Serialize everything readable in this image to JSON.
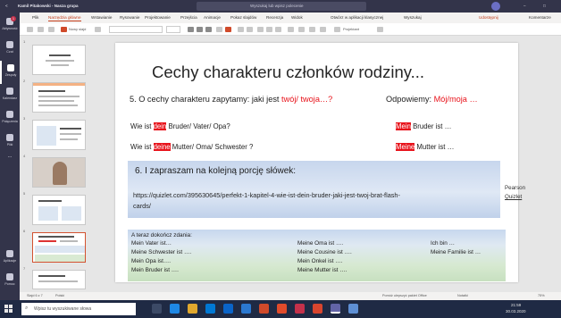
{
  "teams": {
    "back": "<",
    "title": "Kamil Pitakowski - Nasza grupa",
    "search_placeholder": "Wyszukaj lub wpisz polecenie",
    "minimize": "–",
    "maximize": "□",
    "rail": [
      {
        "label": "Aktywność",
        "badge": "1"
      },
      {
        "label": "Czat"
      },
      {
        "label": "Zespoły"
      },
      {
        "label": "Kalendarz"
      },
      {
        "label": "Połączenia"
      },
      {
        "label": "Pliki"
      },
      {
        "label": "..."
      }
    ],
    "rail_bottom": [
      {
        "label": "Aplikacje"
      },
      {
        "label": "Pomoc"
      }
    ]
  },
  "ppt": {
    "menus": [
      "Plik",
      "Narzędzia główne",
      "Wstawianie",
      "Rysowanie",
      "Projektowanie",
      "Przejścia",
      "Animacje",
      "Pokaz slajdów",
      "Recenzja",
      "Widok",
      "Otwórz w aplikacji klasycznej",
      "Wyszukaj"
    ],
    "selected_menu": 1,
    "right_tools": [
      "Udostępnij",
      "Komentarze"
    ],
    "toolbar": {
      "new_slide": "Nowy slajd",
      "designer": "Projektant"
    },
    "status": {
      "slide_counter": "Slajd 6 z 7",
      "language": "Polski",
      "feedback": "Pomóż ulepszyć pakiet Office",
      "notes": "Notatki",
      "zoom": "75%"
    },
    "thumbnails": [
      {
        "number": "1"
      },
      {
        "number": "2"
      },
      {
        "number": "3"
      },
      {
        "number": "4"
      },
      {
        "number": "5"
      },
      {
        "number": "6"
      },
      {
        "number": "7"
      }
    ]
  },
  "slide": {
    "title": "Cechy charakteru członków rodziny...",
    "q_lead": "5. O cechy charakteru zapytamy: jaki jest ",
    "q_red": "twój/ twoja…?",
    "a_lead": "Odpowiemy: ",
    "a_red": "Mój/moja …",
    "l1_a": "Wie ist ",
    "l1_b": "dein",
    "l1_c": " Bruder/ Vater/ Opa?",
    "r1_a": "Mein",
    "r1_b": " Bruder ist …",
    "l2_a": "Wie ist ",
    "l2_b": "deine",
    "l2_c": " Mutter/ Oma/ Schwester ?",
    "r2_a": "Meine",
    "r2_b": " Mutter ist …",
    "sec6": "6.   I zapraszam na kolejną porcję słówek:",
    "url1": "https://quizlet.com/395630645/perfekt-1-kapitel-4-wie-ist-dein-bruder-jaki-jest-twoj-brat-flash-",
    "url2": "cards/",
    "side1": "Pearson",
    "side2": "Quizlet",
    "task": "A teraz dokończ zdania:",
    "cells": [
      [
        "Mein Vater ist…",
        "Meine Oma ist ….",
        "Ich bin …"
      ],
      [
        "Meine Schwester ist ….",
        "Meine Cousine ist ….",
        "Meine Familie ist …"
      ],
      [
        "Mein Opa ist….",
        "Mein Onkel ist ….",
        ""
      ],
      [
        "Mein Bruder ist ….",
        "Meine Mutter ist ….",
        ""
      ]
    ]
  },
  "taskbar": {
    "search_placeholder": "Wpisz tu wyszukiwane słowa",
    "time": "21:59",
    "date": "30.03.2020"
  },
  "colors": {
    "teams_purple": "#33344a",
    "ppt_accent": "#c43e1c",
    "highlight_red": "#e8131b",
    "taskbar": "#1f2a44"
  }
}
